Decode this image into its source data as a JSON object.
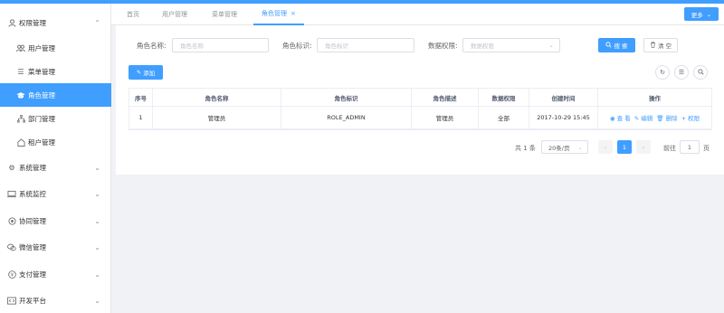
{
  "sidebar": {
    "items": [
      {
        "label": "权限管理",
        "icon": "user-icon",
        "expanded": true
      },
      {
        "label": "用户管理",
        "icon": "users-icon"
      },
      {
        "label": "菜单管理",
        "icon": "list-icon"
      },
      {
        "label": "角色管理",
        "icon": "graduation-cap-icon",
        "active": true
      },
      {
        "label": "部门管理",
        "icon": "tree-icon"
      },
      {
        "label": "租户管理",
        "icon": "home-icon"
      },
      {
        "label": "系统管理",
        "icon": "gear-icon"
      },
      {
        "label": "系统监控",
        "icon": "monitor-icon"
      },
      {
        "label": "协同管理",
        "icon": "target-icon"
      },
      {
        "label": "微信管理",
        "icon": "wechat-icon"
      },
      {
        "label": "支付管理",
        "icon": "yen-icon"
      },
      {
        "label": "开发平台",
        "icon": "code-icon"
      }
    ]
  },
  "tabs": {
    "items": [
      "首页",
      "用户管理",
      "菜单管理",
      "角色管理"
    ],
    "more_label": "更多"
  },
  "search": {
    "role_name_label": "角色名称:",
    "role_name_placeholder": "角色名称",
    "role_key_label": "角色标识:",
    "role_key_placeholder": "角色标识",
    "data_scope_label": "数据权限:",
    "data_scope_placeholder": "数据权限",
    "search_label": "搜 索",
    "clear_label": "清 空"
  },
  "toolbar": {
    "add_label": "添加"
  },
  "table": {
    "headers": [
      "序号",
      "角色名称",
      "角色标识",
      "角色描述",
      "数据权限",
      "创建时间",
      "操作"
    ],
    "rows": [
      {
        "index": "1",
        "name": "管理员",
        "key": "ROLE_ADMIN",
        "desc": "管理员",
        "scope": "全部",
        "created": "2017-10-29 15:45"
      }
    ],
    "actions": [
      "查 看",
      "编辑",
      "删除",
      "权限"
    ]
  },
  "pagination": {
    "total": "共 1 条",
    "page_size": "20条/页",
    "current": "1",
    "goto_label": "前往",
    "goto_value": "1",
    "page_suffix": "页"
  },
  "colors": {
    "accent": "#409eff"
  }
}
